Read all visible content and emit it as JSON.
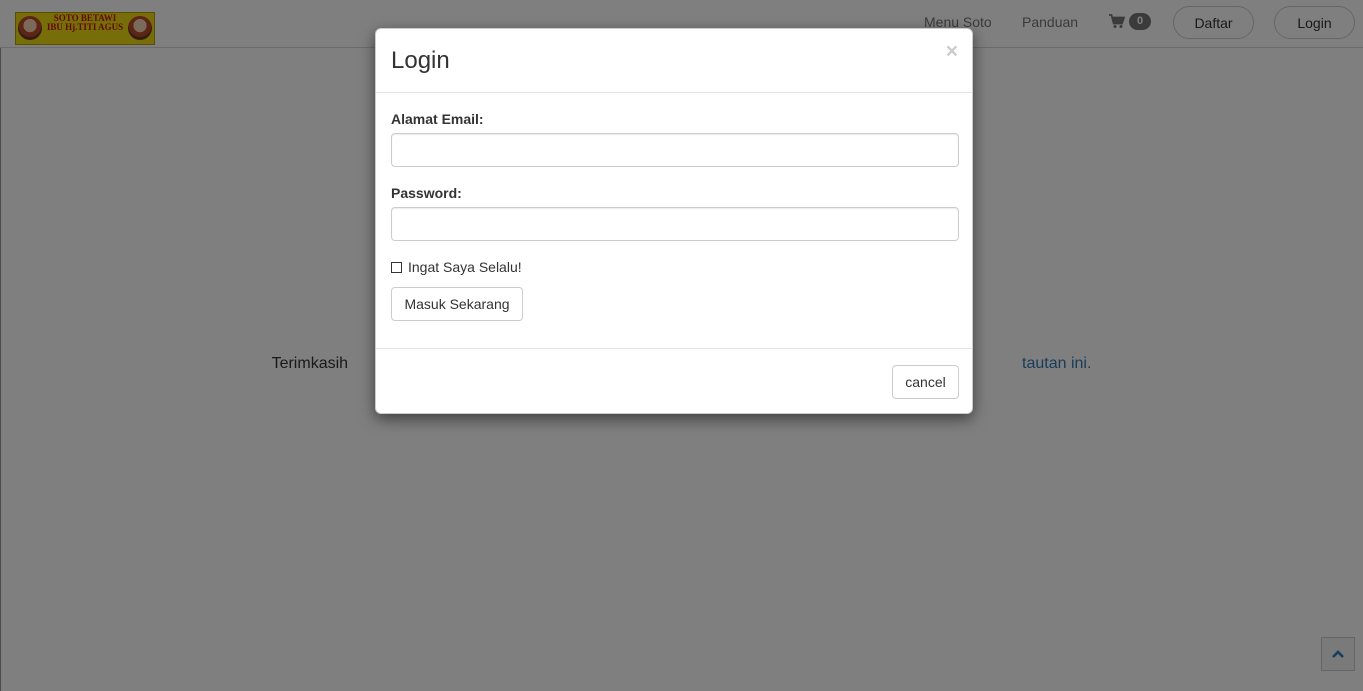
{
  "navbar": {
    "logo": {
      "line1": "SOTO BETAWI",
      "line2": "IBU Hj.TITI AGUS"
    },
    "links": [
      "Menu Soto",
      "Panduan"
    ],
    "cart_count": "0",
    "register_label": "Daftar",
    "login_label": "Login"
  },
  "page": {
    "text_before": "Terimkasih",
    "link_text": "tautan ini."
  },
  "modal": {
    "title": "Login",
    "close_symbol": "×",
    "email_label": "Alamat Email:",
    "email_value": "",
    "password_label": "Password:",
    "password_value": "",
    "remember_label": "Ingat Saya Selalu!",
    "submit_label": "Masuk Sekarang",
    "cancel_label": "cancel"
  },
  "icons": {
    "cart": "shopping-cart-icon",
    "scroll_top": "chevron-up-icon",
    "close": "close-icon"
  },
  "colors": {
    "backdrop": "#000000",
    "link": "#337ab7",
    "badge": "#777777",
    "logo_background": "#f1dc12",
    "logo_text": "#c0170f"
  }
}
